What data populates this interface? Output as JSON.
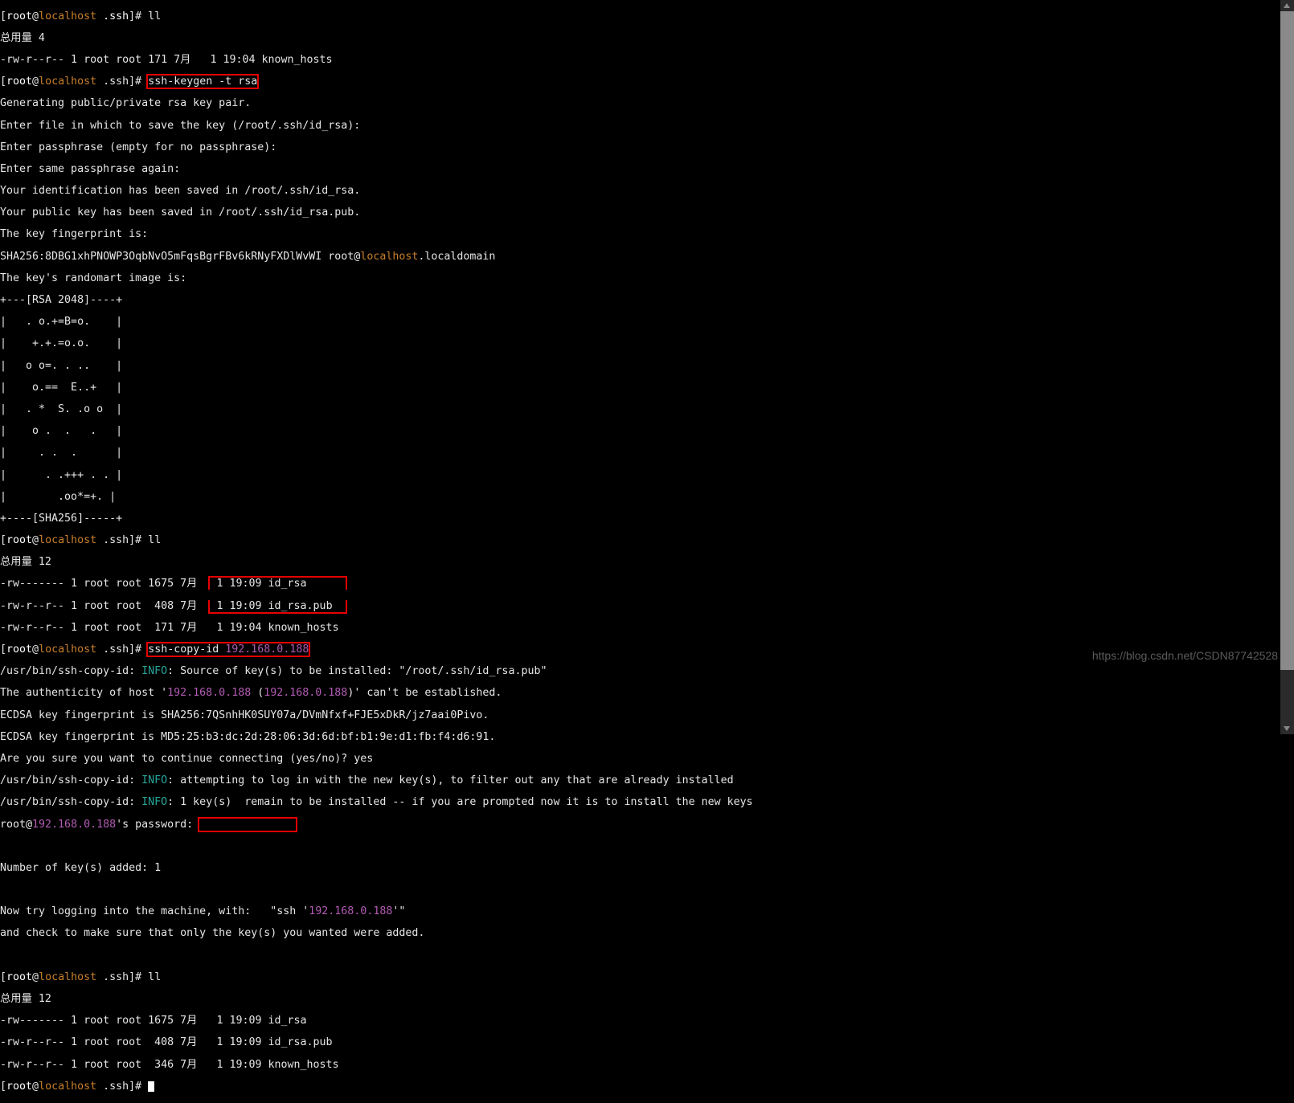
{
  "prompt": {
    "user": "root",
    "at": "@",
    "host": "localhost",
    "path": " .ssh",
    "open": "[",
    "close": "]# "
  },
  "cmd": {
    "ll": "ll",
    "sshkeygen": "ssh-keygen -t rsa",
    "sshcopyid_pre": "ssh-copy-id ",
    "sshcopyid_ip": "192.168.0.188"
  },
  "l": {
    "total4": "总用量 4",
    "kh1": "-rw-r--r-- 1 root root 171 7月   1 19:04 known_hosts",
    "gen1": "Generating public/private rsa key pair.",
    "gen2": "Enter file in which to save the key (/root/.ssh/id_rsa):",
    "gen3": "Enter passphrase (empty for no passphrase):",
    "gen4": "Enter same passphrase again:",
    "gen5": "Your identification has been saved in /root/.ssh/id_rsa.",
    "gen6": "Your public key has been saved in /root/.ssh/id_rsa.pub.",
    "gen7": "The key fingerprint is:",
    "gen8a": "SHA256:8DBG1xhPNOWP3OqbNvO5mFqsBgrFBv6kRNyFXDlWvWI root@",
    "gen8b": "localhost",
    "gen8c": ".localdomain",
    "gen9": "The key's randomart image is:",
    "ra1": "+---[RSA 2048]----+",
    "ra2": "|   . o.+=B=o.    |",
    "ra3": "|    +.+.=o.o.    |",
    "ra4": "|   o o=. . ..    |",
    "ra5": "|    o.==  E..+   |",
    "ra6": "|   . *  S. .o o  |",
    "ra7": "|    o .  .   .   |",
    "ra8": "|     . .  .      |",
    "ra9": "|      . .+++ . . |",
    "ra10": "|        .oo*=+. |",
    "ra11": "+----[SHA256]-----+",
    "total12": "总用量 12",
    "ls2a_pre": "-rw------- 1 root root 1675 7月  ",
    "ls2a_box": " 1 19:09 id_rsa      ",
    "ls2b_pre": "-rw-r--r-- 1 root root  408 7月  ",
    "ls2b_box": " 1 19:09 id_rsa.pub  ",
    "ls2c": "-rw-r--r-- 1 root root  171 7月   1 19:04 known_hosts",
    "copy1_a": "/usr/bin/ssh-copy-id: ",
    "copy1_info": "INFO",
    "copy1_b": ": Source of key(s) to be installed: \"/root/.ssh/id_rsa.pub\"",
    "auth1_a": "The authenticity of host '",
    "auth1_ip1": "192.168.0.188",
    "auth1_mid": " (",
    "auth1_ip2": "192.168.0.188",
    "auth1_end": ")' can't be established.",
    "ecdsa1": "ECDSA key fingerprint is SHA256:7QSnhHK0SUY07a/DVmNfxf+FJE5xDkR/jz7aai0Pivo.",
    "ecdsa2": "ECDSA key fingerprint is MD5:25:b3:dc:2d:28:06:3d:6d:bf:b1:9e:d1:fb:f4:d6:91.",
    "areyou": "Are you sure you want to continue connecting (yes/no)? yes",
    "copy2_b": ": attempting to log in with the new key(s), to filter out any that are already installed",
    "copy3_b": ": 1 key(s)  remain to be installed -- if you are prompted now it is to install the new keys",
    "pw_a": "root@",
    "pw_ip": "192.168.0.188",
    "pw_b": "'s password: ",
    "pw_box": "               ",
    "num": "Number of key(s) added: 1",
    "try_a": "Now try logging into the machine, with:   \"ssh '",
    "try_ip": "192.168.0.188",
    "try_b": "'\"",
    "check": "and check to make sure that only the key(s) you wanted were added.",
    "ls3a": "-rw------- 1 root root 1675 7月   1 19:09 id_rsa",
    "ls3b": "-rw-r--r-- 1 root root  408 7月   1 19:09 id_rsa.pub",
    "ls3c": "-rw-r--r-- 1 root root  346 7月   1 19:09 known_hosts"
  },
  "watermark": "https://blog.csdn.net/CSDN87742528"
}
